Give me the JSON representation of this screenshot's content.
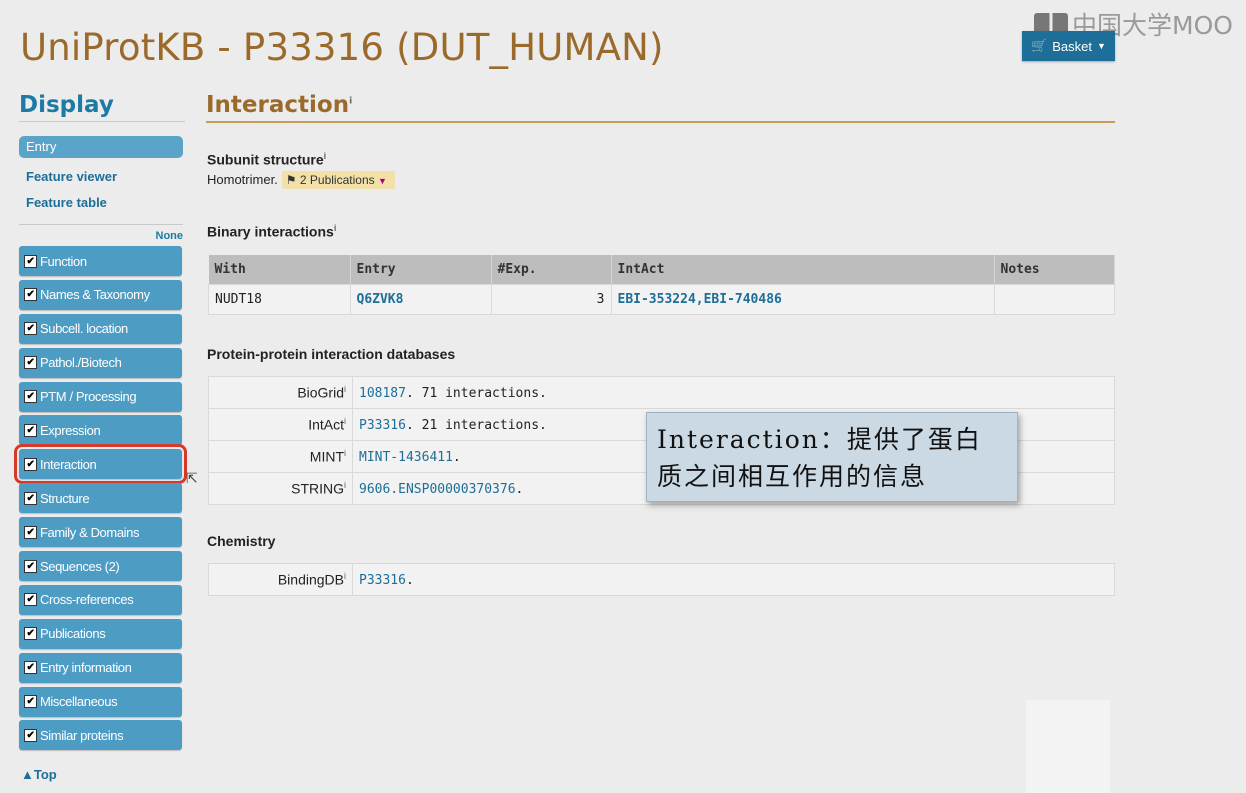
{
  "page": {
    "title": "UniProtKB - P33316 (DUT_HUMAN)",
    "watermark": "中国大学MOO",
    "basket_label": "Basket"
  },
  "sidebar": {
    "heading": "Display",
    "entry_label": "Entry",
    "links": [
      "Feature viewer",
      "Feature table"
    ],
    "none_label": "None",
    "sections": [
      "Function",
      "Names & Taxonomy",
      "Subcell. location",
      "Pathol./Biotech",
      "PTM / Processing",
      "Expression",
      "Interaction",
      "Structure",
      "Family & Domains",
      "Sequences (2)",
      "Cross-references",
      "Publications",
      "Entry information",
      "Miscellaneous",
      "Similar proteins"
    ],
    "active_section": "Interaction",
    "top_label": "Top"
  },
  "main": {
    "heading": "Interaction",
    "subunit": {
      "title": "Subunit structure",
      "text": "Homotrimer.",
      "publications": "2 Publications"
    },
    "binary": {
      "title": "Binary interactions",
      "headers": [
        "With",
        "Entry",
        "#Exp.",
        "IntAct",
        "Notes"
      ],
      "rows": [
        {
          "with": "NUDT18",
          "entry": "Q6ZVK8",
          "exp": "3",
          "intact": "EBI-353224,EBI-740486",
          "notes": ""
        }
      ]
    },
    "ppi": {
      "title": "Protein-protein interaction databases",
      "rows": [
        {
          "db": "BioGrid",
          "id": "108187",
          "rest": ". 71 interactions."
        },
        {
          "db": "IntAct",
          "id": "P33316",
          "rest": ". 21 interactions."
        },
        {
          "db": "MINT",
          "id": "MINT-1436411",
          "rest": "."
        },
        {
          "db": "STRING",
          "id": "9606.ENSP00000370376",
          "rest": "."
        }
      ]
    },
    "chemistry": {
      "title": "Chemistry",
      "rows": [
        {
          "db": "BindingDB",
          "id": "P33316",
          "rest": "."
        }
      ]
    }
  },
  "callout": {
    "line1": "Interaction：提供了蛋白",
    "line2": "质之间相互作用的信息"
  }
}
